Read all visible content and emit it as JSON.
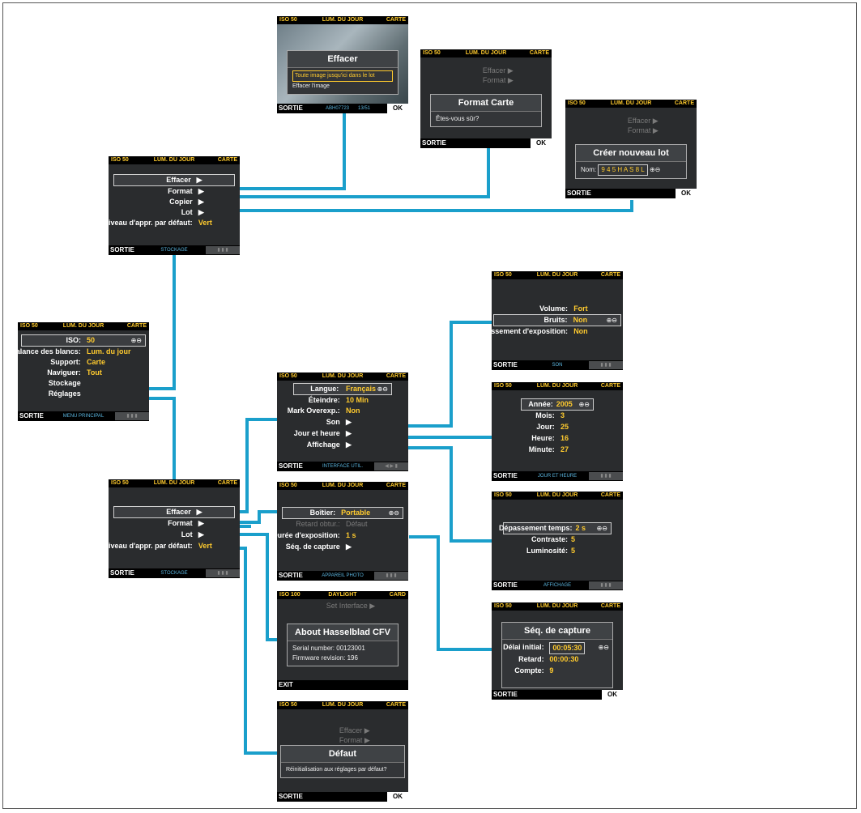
{
  "colors": {
    "connector": "#1a9fcb",
    "status_text": "#ffcb2e",
    "screen_bg": "#2a2c2e"
  },
  "screens": {
    "erase": {
      "top": [
        "ISO 50",
        "LUM. DU JOUR",
        "CARTE"
      ],
      "dialog_title": "Effacer",
      "rows": [
        "Toute image jusqu'ici dans le lot",
        "Effacer l'image"
      ],
      "bottom": {
        "left": "SORTIE",
        "mid": "ABH07723",
        "mid2": "13/51",
        "right": "OK"
      }
    },
    "format": {
      "top": [
        "ISO 50",
        "LUM. DU JOUR",
        "CARTE"
      ],
      "bg_rows": [
        "Effacer ▶",
        "Format ▶"
      ],
      "dialog_title": "Format Carte",
      "body": "Êtes-vous sûr?",
      "bottom": {
        "left": "SORTIE",
        "right": "OK"
      }
    },
    "newbatch": {
      "top": [
        "ISO 50",
        "LUM. DU JOUR",
        "CARTE"
      ],
      "bg_rows": [
        "Effacer ▶",
        "Format ▶"
      ],
      "dialog_title": "Créer nouveau lot",
      "name_label": "Nom:",
      "name_value": "9 4 5 H A S 8 L",
      "bottom": {
        "left": "SORTIE",
        "right": "OK"
      }
    },
    "storage1": {
      "top": [
        "ISO 50",
        "LUM. DU JOUR",
        "CARTE"
      ],
      "rows": [
        {
          "label": "Effacer",
          "value": "▶"
        },
        {
          "label": "Format",
          "value": "▶"
        },
        {
          "label": "Copier",
          "value": "▶"
        },
        {
          "label": "Lot",
          "value": "▶"
        },
        {
          "label": "Niveau d'appr. par défaut:",
          "value": "Vert"
        }
      ],
      "bottom": {
        "left": "SORTIE",
        "mid": "STOCKAGE",
        "right": "▮ ▮ ▮"
      }
    },
    "main": {
      "top": [
        "ISO 50",
        "LUM. DU JOUR",
        "CARTE"
      ],
      "rows": [
        {
          "label": "ISO:",
          "value": "50"
        },
        {
          "label": "Balance des blancs:",
          "value": "Lum. du jour"
        },
        {
          "label": "Support:",
          "value": "Carte"
        },
        {
          "label": "Naviguer:",
          "value": "Tout"
        },
        {
          "label": "Stockage",
          "value": ""
        },
        {
          "label": "Réglages",
          "value": ""
        }
      ],
      "bottom": {
        "left": "SORTIE",
        "mid": "MENU PRINCIPAL",
        "right": "▮ ▮ ▮"
      }
    },
    "storage2": {
      "top": [
        "ISO 50",
        "LUM. DU JOUR",
        "CARTE"
      ],
      "rows": [
        {
          "label": "Effacer",
          "value": "▶"
        },
        {
          "label": "Format",
          "value": "▶"
        },
        {
          "label": "Lot",
          "value": "▶"
        },
        {
          "label": "Niveau d'appr. par défaut:",
          "value": "Vert"
        }
      ],
      "bottom": {
        "left": "SORTIE",
        "mid": "STOCKAGE",
        "right": "▮ ▮ ▮"
      }
    },
    "interface": {
      "top": [
        "ISO 50",
        "LUM. DU JOUR",
        "CARTE"
      ],
      "rows": [
        {
          "label": "Langue:",
          "value": "Français"
        },
        {
          "label": "Éteindre:",
          "value": "10 Min"
        },
        {
          "label": "Mark Overexp.:",
          "value": "Non"
        },
        {
          "label": "Son",
          "value": "▶"
        },
        {
          "label": "Jour et heure",
          "value": "▶"
        },
        {
          "label": "Affichage",
          "value": "▶"
        }
      ],
      "bottom": {
        "left": "SORTIE",
        "mid": "INTERFACE UTIL.",
        "right": "◀ ▶ ▮"
      }
    },
    "camera": {
      "top": [
        "ISO 50",
        "LUM. DU JOUR",
        "CARTE"
      ],
      "rows": [
        {
          "label": "Boîtier:",
          "value": "Portable"
        },
        {
          "label": "Retard obtur.:",
          "value": "Défaut"
        },
        {
          "label": "Durée d'exposition:",
          "value": "1 s"
        },
        {
          "label": "Séq. de capture",
          "value": "▶"
        }
      ],
      "bottom": {
        "left": "SORTIE",
        "mid": "APPAREIL PHOTO",
        "right": "▮ ▮ ▮"
      }
    },
    "about": {
      "top": [
        "ISO 100",
        "DAYLIGHT",
        "CARD"
      ],
      "bg_rows": [
        "Set Interface ▶"
      ],
      "dialog_title": "About Hasselblad CFV",
      "lines": [
        "Serial number: 00123001",
        "Firmware revision: 196"
      ],
      "bottom": {
        "left": "EXIT"
      }
    },
    "default": {
      "top": [
        "ISO 50",
        "LUM. DU JOUR",
        "CARTE"
      ],
      "bg_rows": [
        "Effacer ▶",
        "Format ▶"
      ],
      "dialog_title": "Défaut",
      "body": "Réinitialisation aux réglages par défaut?",
      "bottom": {
        "left": "SORTIE",
        "right": "OK"
      }
    },
    "sound": {
      "top": [
        "ISO 50",
        "LUM. DU JOUR",
        "CARTE"
      ],
      "rows": [
        {
          "label": "Volume:",
          "value": "Fort"
        },
        {
          "label": "Bruits:",
          "value": "Non"
        },
        {
          "label": "Avertissement d'exposition:",
          "value": "Non"
        }
      ],
      "bottom": {
        "left": "SORTIE",
        "mid": "SON",
        "right": "▮ ▮ ▮"
      }
    },
    "datetime": {
      "top": [
        "ISO 50",
        "LUM. DU JOUR",
        "CARTE"
      ],
      "rows": [
        {
          "label": "Année:",
          "value": "2005"
        },
        {
          "label": "Mois:",
          "value": "3"
        },
        {
          "label": "Jour:",
          "value": "25"
        },
        {
          "label": "Heure:",
          "value": "16"
        },
        {
          "label": "Minute:",
          "value": "27"
        }
      ],
      "bottom": {
        "left": "SORTIE",
        "mid": "JOUR ET HEURE",
        "right": "▮ ▮ ▮"
      }
    },
    "display": {
      "top": [
        "ISO 50",
        "LUM. DU JOUR",
        "CARTE"
      ],
      "rows": [
        {
          "label": "Dépassement temps:",
          "value": "2 s"
        },
        {
          "label": "Contraste:",
          "value": "5"
        },
        {
          "label": "Luminosité:",
          "value": "5"
        }
      ],
      "bottom": {
        "left": "SORTIE",
        "mid": "AFFICHAGE",
        "right": "▮ ▮ ▮"
      }
    },
    "capseq": {
      "top": [
        "ISO 50",
        "LUM. DU JOUR",
        "CARTE"
      ],
      "dialog_title": "Séq. de capture",
      "rows": [
        {
          "label": "Délai initial:",
          "value": "00:05:30"
        },
        {
          "label": "Retard:",
          "value": "00:00:30"
        },
        {
          "label": "Compte:",
          "value": "9"
        }
      ],
      "bottom": {
        "left": "SORTIE",
        "right": "OK"
      }
    }
  }
}
